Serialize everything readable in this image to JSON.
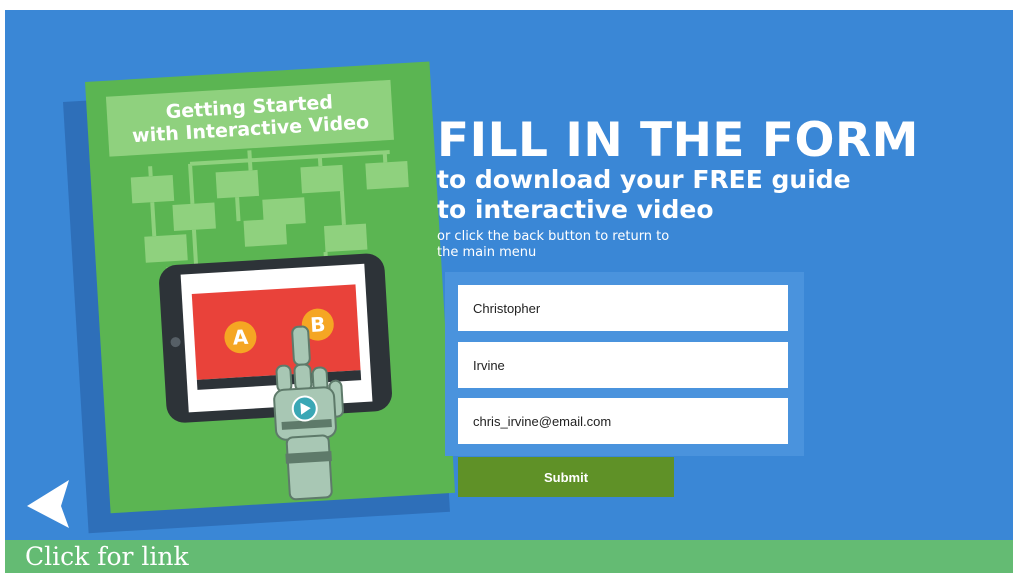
{
  "book": {
    "title_line1": "Getting Started",
    "title_line2": "with Interactive Video",
    "badge_a": "A",
    "badge_b": "B"
  },
  "headline": {
    "title": "FILL IN THE FORM",
    "subtitle_pre": "to download your ",
    "subtitle_emph": "FREE",
    "subtitle_post": " guide",
    "subtitle_line2": "to interactive video",
    "note_line1": "or click the back button to return to",
    "note_line2": "the main menu"
  },
  "form": {
    "first_name": "Christopher",
    "last_name": "Irvine",
    "email": "chris_irvine@email.com",
    "submit_label": "Submit"
  },
  "footer": {
    "link_text": "Click for link"
  },
  "colors": {
    "background": "#3a87d6",
    "book": "#5bb552",
    "submit": "#5f9127",
    "footer": "#64bb73"
  },
  "icons": {
    "back": "back-arrow-icon",
    "play": "play-icon"
  }
}
